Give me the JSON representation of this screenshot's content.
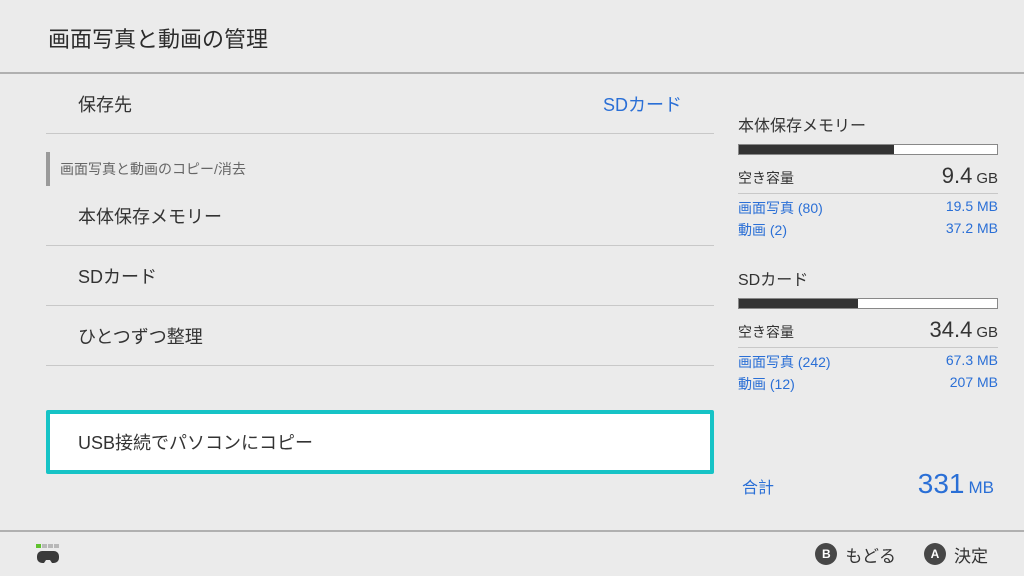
{
  "header": {
    "title": "画面写真と動画の管理"
  },
  "main": {
    "save_dest": {
      "label": "保存先",
      "value": "SDカード"
    },
    "section_label": "画面写真と動画のコピー/消去",
    "items": [
      {
        "label": "本体保存メモリー"
      },
      {
        "label": "SDカード"
      },
      {
        "label": "ひとつずつ整理"
      }
    ],
    "usb_copy": {
      "label": "USB接続でパソコンにコピー"
    }
  },
  "storage": [
    {
      "title": "本体保存メモリー",
      "fill_pct": 60,
      "free_label": "空き容量",
      "free_value": "9.4",
      "free_unit": "GB",
      "details": [
        {
          "label": "画面写真 (80)",
          "value": "19.5 MB"
        },
        {
          "label": "動画 (2)",
          "value": "37.2 MB"
        }
      ]
    },
    {
      "title": "SDカード",
      "fill_pct": 46,
      "free_label": "空き容量",
      "free_value": "34.4",
      "free_unit": "GB",
      "details": [
        {
          "label": "画面写真 (242)",
          "value": "67.3 MB"
        },
        {
          "label": "動画 (12)",
          "value": "207 MB"
        }
      ]
    }
  ],
  "total": {
    "label": "合計",
    "value": "331",
    "unit": "MB"
  },
  "footer": {
    "back": {
      "btn": "B",
      "label": "もどる"
    },
    "ok": {
      "btn": "A",
      "label": "決定"
    }
  }
}
